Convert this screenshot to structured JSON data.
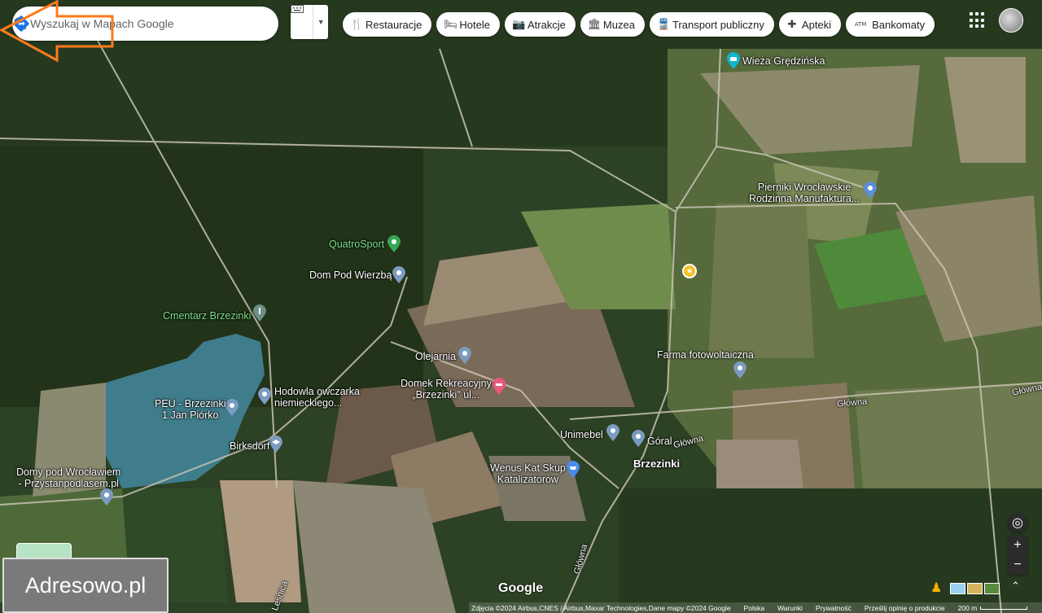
{
  "search": {
    "placeholder": "Wyszukaj w Mapach Google"
  },
  "toolbar": {
    "keyboard_icon": "keyboard-icon",
    "directions_icon": "directions-icon"
  },
  "categories": [
    {
      "label": "Restauracje",
      "icon": "🍴"
    },
    {
      "label": "Hotele",
      "icon": "🛏"
    },
    {
      "label": "Atrakcje",
      "icon": "📷"
    },
    {
      "label": "Muzea",
      "icon": "🏛"
    },
    {
      "label": "Transport publiczny",
      "icon": "🚆"
    },
    {
      "label": "Apteki",
      "icon": "✚"
    },
    {
      "label": "Bankomaty",
      "icon": "ATM"
    }
  ],
  "places": [
    {
      "name": "Wieża Grędzińska"
    },
    {
      "name": "Pierniki Wrocławskie\nRodzinna Manufaktura..."
    },
    {
      "name": "QuatroSport"
    },
    {
      "name": "Dom Pod Wierzbą"
    },
    {
      "name": "Cmentarz Brzezinki"
    },
    {
      "name": "Olejarnia"
    },
    {
      "name": "Domek Rekreacyjny\n„Brzezinki\" ul..."
    },
    {
      "name": "Farma fotowoltaiczna"
    },
    {
      "name": "Hodowla owczarka\nniemieckiego..."
    },
    {
      "name": "PEU - Brzezinki\n1 Jan Piórko"
    },
    {
      "name": "Birksdorf"
    },
    {
      "name": "Unimebel"
    },
    {
      "name": "Góral"
    },
    {
      "name": "Brzezinki"
    },
    {
      "name": "Wenus Kat Skup\nKatalizatorów"
    },
    {
      "name": "Domy pod Wrocławiem\n- Przystanpodlasem.pl"
    }
  ],
  "roads": {
    "glowna_1": "Główna",
    "glowna_2": "Główna",
    "glowna_3": "Główna",
    "glowna_4": "Główna",
    "bottom": "Leśnica"
  },
  "watermark": "Adresowo.pl",
  "google_logo": "Google",
  "footer": {
    "attribution": "Zdjęcia ©2024 Airbus,CNES / Airbus,Maxar Technologies,Dane mapy ©2024 Google",
    "country": "Polska",
    "terms": "Warunki",
    "privacy": "Prywatność",
    "feedback": "Prześlij opinię o produkcie",
    "scale": "200 m"
  },
  "colors": {
    "marker_star": "#f6c026",
    "arrow": "#ff7a1a",
    "pin_blue": "#5b8fd6",
    "pin_green": "#34a853",
    "pin_pink": "#e8587b",
    "label_green": "#7ee58a"
  }
}
